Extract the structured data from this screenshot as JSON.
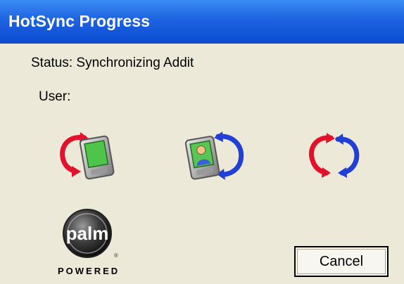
{
  "window": {
    "title": "HotSync Progress",
    "titlebar_color": "#0a4bd1",
    "background_color": "#ece9d8"
  },
  "status": {
    "text": "Status: Synchronizing Addit"
  },
  "user": {
    "text": "User:"
  },
  "icons": [
    {
      "name": "handheld-sync-icon",
      "semantic": "pc-to-handheld-sync"
    },
    {
      "name": "contacts-sync-icon",
      "semantic": "handheld-addressbook-sync"
    },
    {
      "name": "hotsync-arrows-icon",
      "semantic": "hotsync-red-blue-arrows"
    }
  ],
  "logo": {
    "wordmark": "palm",
    "tagline": "POWERED"
  },
  "buttons": {
    "cancel_label": "Cancel"
  },
  "colors": {
    "arrow_red": "#e3122a",
    "arrow_blue": "#1f3fd6"
  }
}
